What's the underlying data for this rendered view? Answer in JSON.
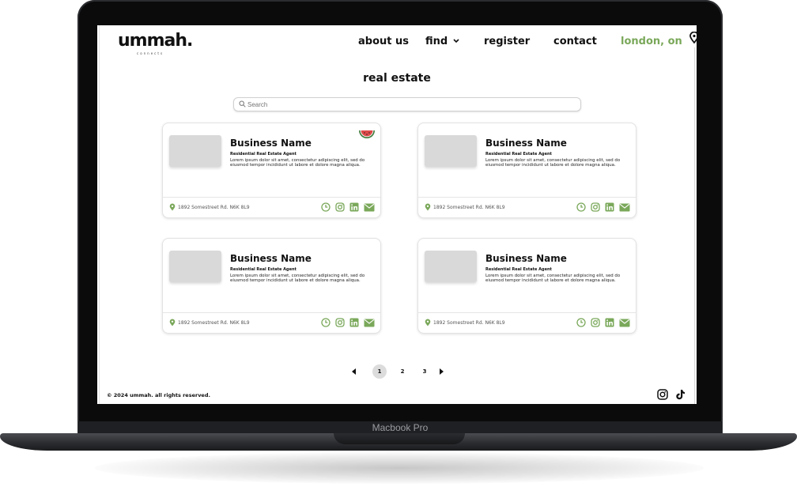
{
  "device": {
    "label": "Macbook Pro"
  },
  "brand": {
    "logo": "ummah.",
    "tagline": "connects"
  },
  "nav": {
    "about": "about us",
    "find": "find",
    "register": "register",
    "contact": "contact",
    "location": "london, on"
  },
  "page": {
    "title": "real estate"
  },
  "search": {
    "placeholder": "Search"
  },
  "cards": [
    {
      "name": "Business Name",
      "role": "Residential Real Estate Agent",
      "description": "Lorem ipsum dolor sit amet, consectetur adipiscing elit, sed do eiusmod tempor incididunt ut labore et dolore magna aliqua.",
      "address": "1892 Somestreet Rd. N6K 8L9"
    },
    {
      "name": "Business Name",
      "role": "Residential Real Estate Agent",
      "description": "Lorem ipsum dolor sit amet, consectetur adipiscing elit, sed do eiusmod tempor incididunt ut labore et dolore magna aliqua.",
      "address": "1892 Somestreet Rd. N6K 8L9"
    },
    {
      "name": "Business Name",
      "role": "Residential Real Estate Agent",
      "description": "Lorem ipsum dolor sit amet, consectetur adipiscing elit, sed do eiusmod tempor incididunt ut labore et dolore magna aliqua.",
      "address": "1892 Somestreet Rd. N6K 8L9"
    },
    {
      "name": "Business Name",
      "role": "Residential Real Estate Agent",
      "description": "Lorem ipsum dolor sit amet, consectetur adipiscing elit, sed do eiusmod tempor incididunt ut labore et dolore magna aliqua.",
      "address": "1892 Somestreet Rd. N6K 8L9"
    }
  ],
  "card_icons": [
    "clock-icon",
    "instagram-icon",
    "linkedin-icon",
    "mail-icon"
  ],
  "pagination": {
    "pages": [
      "1",
      "2",
      "3"
    ],
    "current": "1"
  },
  "footer": {
    "copyright": "© 2024 ummah. all rights reserved."
  },
  "colors": {
    "accent": "#7aa85a",
    "text": "#111111",
    "thumb": "#d9d9d9"
  }
}
